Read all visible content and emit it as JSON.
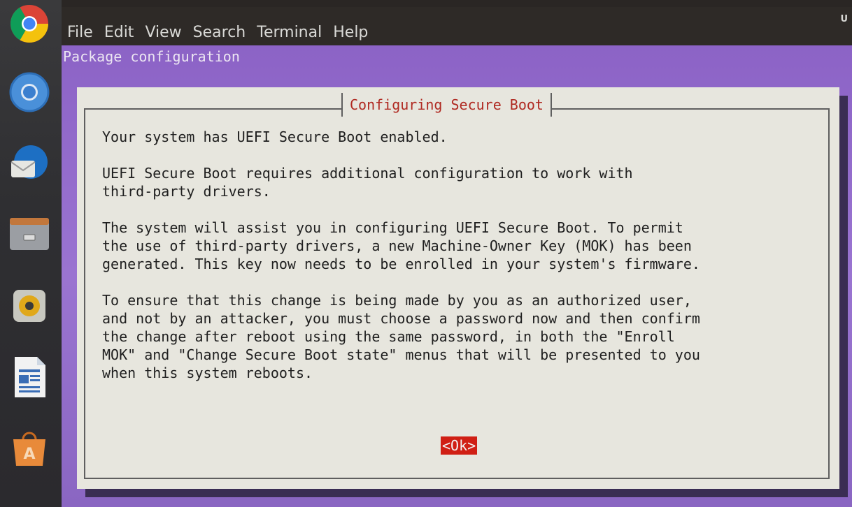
{
  "dock": {
    "items": [
      {
        "icon": "chrome-icon",
        "name": "dock-item-chrome"
      },
      {
        "icon": "chromium-icon",
        "name": "dock-item-chromium"
      },
      {
        "icon": "thunderbird-icon",
        "name": "dock-item-thunderbird"
      },
      {
        "icon": "files-icon",
        "name": "dock-item-files"
      },
      {
        "icon": "rhythmbox-icon",
        "name": "dock-item-rhythmbox"
      },
      {
        "icon": "writer-icon",
        "name": "dock-item-writer"
      },
      {
        "icon": "software-icon",
        "name": "dock-item-software"
      }
    ]
  },
  "window": {
    "corner_mark": "U"
  },
  "menubar": {
    "items": [
      "File",
      "Edit",
      "View",
      "Search",
      "Terminal",
      "Help"
    ]
  },
  "terminal": {
    "header": "Package configuration"
  },
  "dialog": {
    "title": "Configuring Secure Boot",
    "paragraphs": [
      "Your system has UEFI Secure Boot enabled.",
      "UEFI Secure Boot requires additional configuration to work with\nthird-party drivers.",
      "The system will assist you in configuring UEFI Secure Boot. To permit\nthe use of third-party drivers, a new Machine-Owner Key (MOK) has been\ngenerated. This key now needs to be enrolled in your system's firmware.",
      "To ensure that this change is being made by you as an authorized user,\nand not by an attacker, you must choose a password now and then confirm\nthe change after reboot using the same password, in both the \"Enroll\nMOK\" and \"Change Secure Boot state\" menus that will be presented to you\nwhen this system reboots."
    ],
    "ok_label": "<Ok>"
  },
  "colors": {
    "terminal_background": "#8f6cc9",
    "dialog_background": "#e7e6de",
    "title_text": "#b02a22",
    "ok_button": "#d01f14"
  }
}
